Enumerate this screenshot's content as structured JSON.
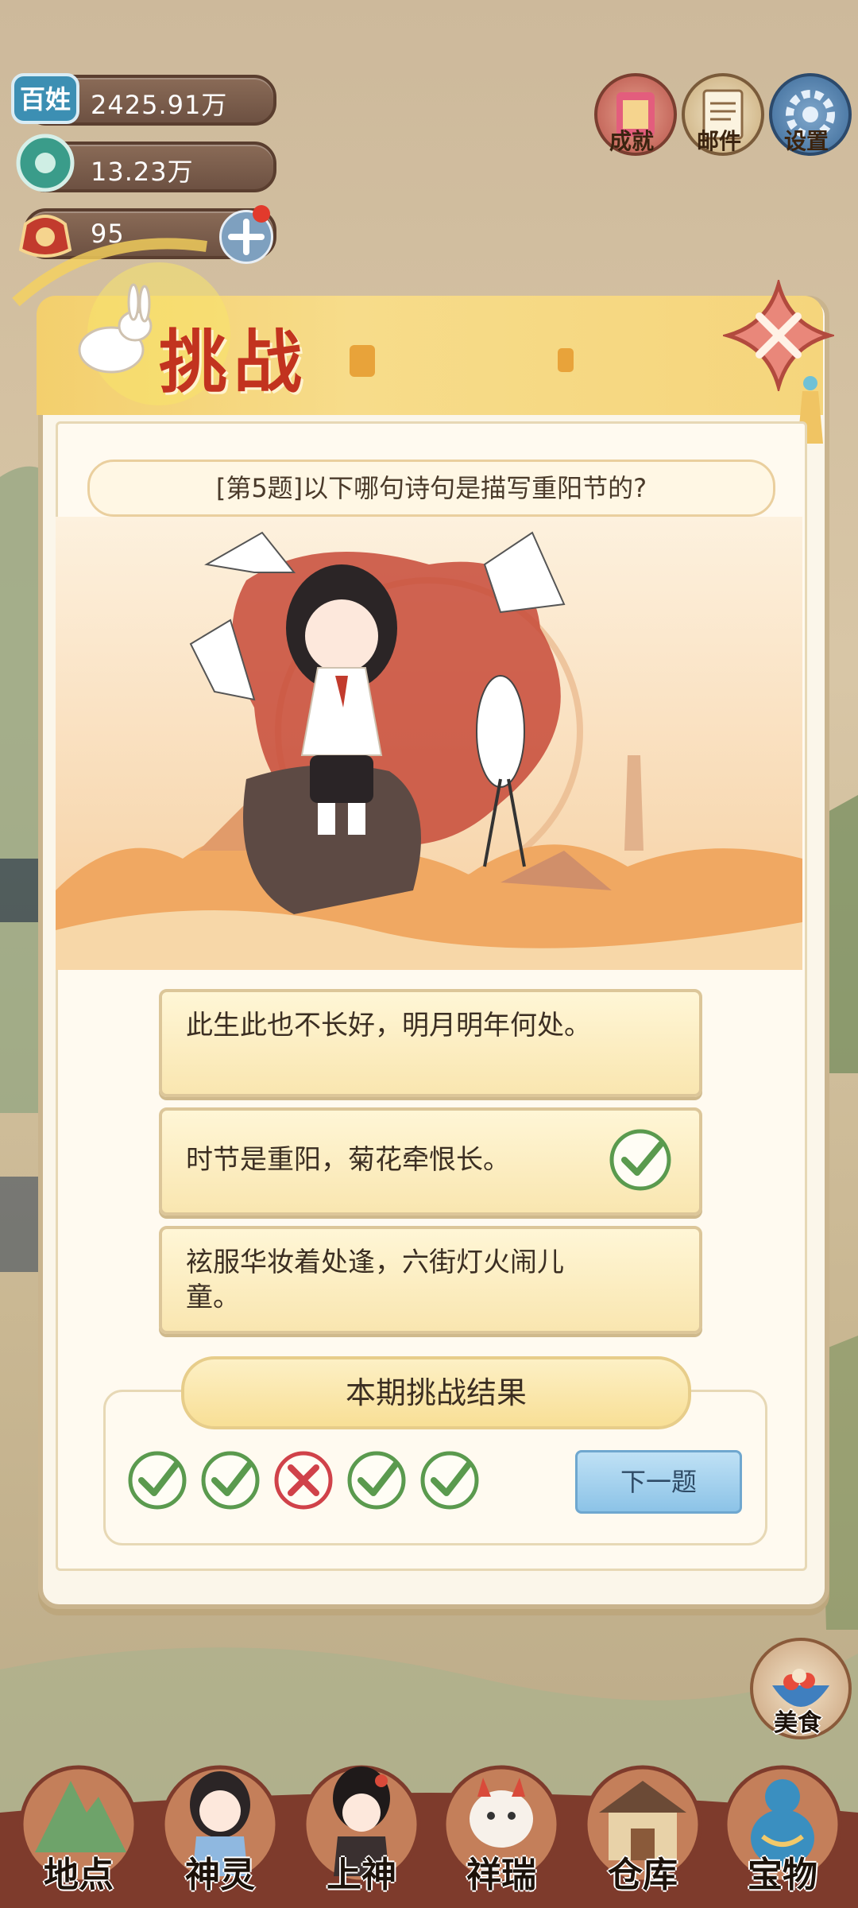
{
  "resources": [
    {
      "icon": "people-icon",
      "label": "百姓",
      "value": "2425.91万"
    },
    {
      "icon": "jade-icon",
      "value": "13.23万"
    },
    {
      "icon": "pouch-icon",
      "value": "95"
    }
  ],
  "top_buttons": [
    {
      "icon": "achievement-scroll-icon",
      "label": "成就"
    },
    {
      "icon": "mail-letter-icon",
      "label": "邮件"
    },
    {
      "icon": "settings-gear-icon",
      "label": "设置"
    }
  ],
  "dialog": {
    "title": "挑战",
    "question": "[第5题]以下哪句诗句是描写重阳节的?",
    "options": [
      {
        "text": "此生此也不长好，明月明年何处。",
        "correct": false
      },
      {
        "text": "时节是重阳，菊花牵恨长。",
        "correct": true
      },
      {
        "text": "袨服华妆着处逢，六街灯火闹儿童。",
        "correct": false
      }
    ],
    "result_title": "本期挑战结果",
    "results": [
      "correct",
      "correct",
      "wrong",
      "correct",
      "correct"
    ],
    "next_button": "下一题"
  },
  "side_button": {
    "icon": "food-bowl-icon",
    "label": "美食"
  },
  "nav": [
    {
      "icon": "mountain-icon",
      "label": "地点"
    },
    {
      "icon": "spirit-girl-icon",
      "label": "神灵"
    },
    {
      "icon": "deity-icon",
      "label": "上神"
    },
    {
      "icon": "beast-icon",
      "label": "祥瑞"
    },
    {
      "icon": "warehouse-icon",
      "label": "仓库"
    },
    {
      "icon": "gourd-treasure-icon",
      "label": "宝物"
    }
  ],
  "colors": {
    "accent_red": "#c2331f",
    "correct_green": "#5a9a4e",
    "wrong_red": "#d0424a",
    "gold": "#f3cf6d"
  }
}
